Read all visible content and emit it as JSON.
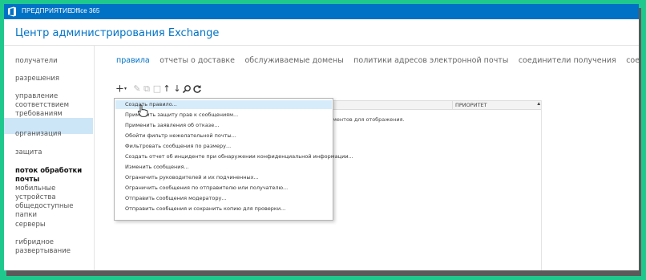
{
  "topbar": {
    "brand_label": "ПРЕДПРИЯТИЕ",
    "suite_label": "Office 365",
    "logo_icon": "office-logo-icon"
  },
  "app": {
    "title": "Центр администрирования Exchange"
  },
  "sidebar": {
    "items": [
      {
        "label": "получатели",
        "active": false
      },
      {
        "label": "разрешения",
        "active": false
      },
      {
        "label": "управление соответствием требованиям",
        "active": false
      },
      {
        "label": "организация",
        "active": false
      },
      {
        "label": "защита",
        "active": false
      },
      {
        "label": "поток обработки почты",
        "active": true
      },
      {
        "label": "мобильные устройства",
        "active": false
      },
      {
        "label": "общедоступные папки",
        "active": false
      },
      {
        "label": "серверы",
        "active": false
      },
      {
        "label": "гибридное развертывание",
        "active": false
      }
    ]
  },
  "tabs": [
    {
      "label": "правила",
      "active": true
    },
    {
      "label": "отчеты о доставке",
      "active": false
    },
    {
      "label": "обслуживаемые домены",
      "active": false
    },
    {
      "label": "политики адресов электронной почты",
      "active": false
    },
    {
      "label": "соединители получения",
      "active": false
    },
    {
      "label": "соединители отправки",
      "active": false
    }
  ],
  "toolbar": {
    "icons": [
      "add-icon",
      "edit-icon",
      "copy-icon",
      "delete-icon",
      "move-up-icon",
      "move-down-icon",
      "search-icon",
      "refresh-icon"
    ]
  },
  "grid": {
    "priority_header": "ПРИОРИТЕТ",
    "empty_text": "ментов для отображения."
  },
  "add_menu": {
    "items": [
      "Создать правило...",
      "Применить защиту прав к сообщениям...",
      "Применить заявления об отказе...",
      "Обойти фильтр нежелательной почты...",
      "Фильтровать сообщения по размеру...",
      "Создать отчет об инциденте при обнаружении конфиденциальной информации...",
      "Изменить сообщения...",
      "Ограничить руководителей и их подчиненных...",
      "Ограничить сообщения по отправителю или получателю...",
      "Отправить сообщения модератору...",
      "Отправить сообщения и сохранить копию для проверки..."
    ]
  },
  "colors": {
    "accent": "#0072c6",
    "sidebar_active_bg": "#cde6f7",
    "menu_highlight": "#d7ecfb",
    "frame": "#1fc98e"
  }
}
